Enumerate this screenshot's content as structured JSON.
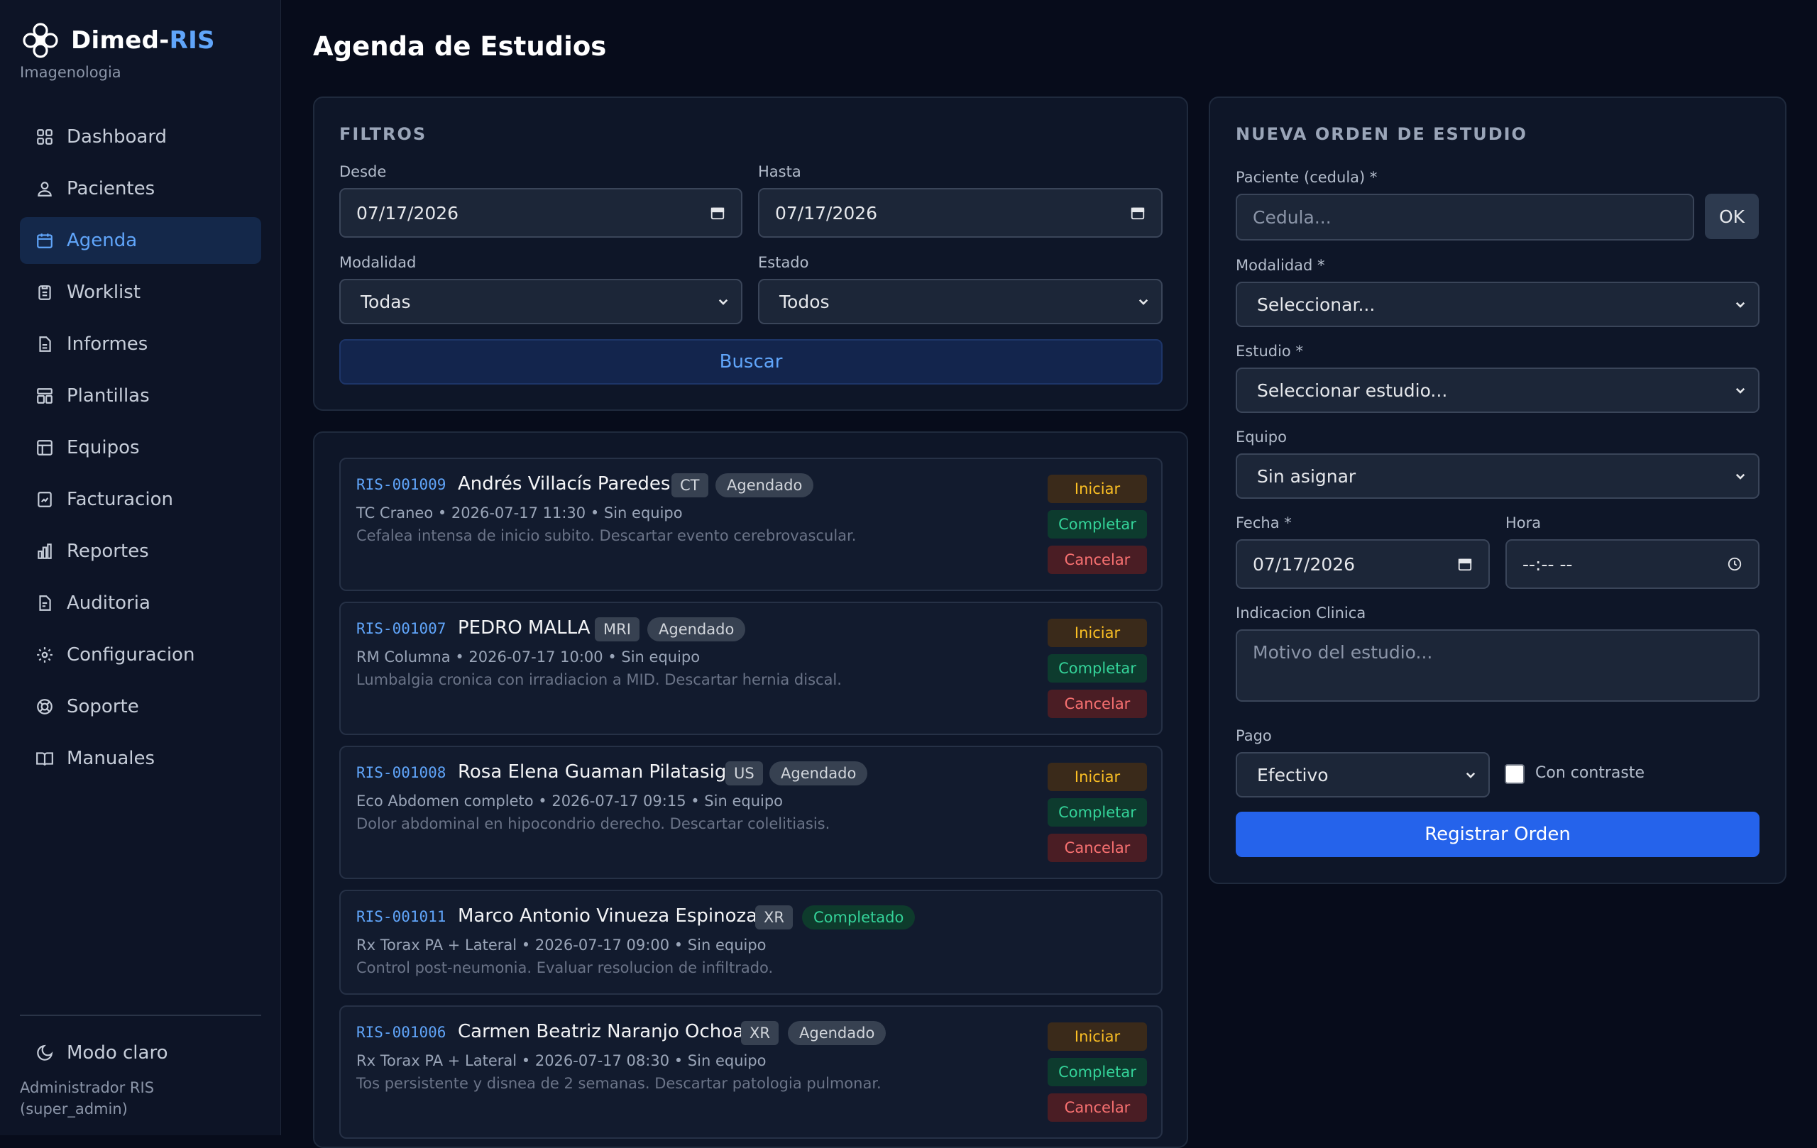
{
  "brand": {
    "name_main": "Dimed-",
    "name_accent": "RIS",
    "subtitle": "Imagenologia"
  },
  "sidebar": {
    "items": [
      {
        "label": "Dashboard",
        "icon": "dashboard-icon"
      },
      {
        "label": "Pacientes",
        "icon": "user-icon"
      },
      {
        "label": "Agenda",
        "icon": "calendar-icon",
        "active": true
      },
      {
        "label": "Worklist",
        "icon": "clipboard-icon"
      },
      {
        "label": "Informes",
        "icon": "document-icon"
      },
      {
        "label": "Plantillas",
        "icon": "template-icon"
      },
      {
        "label": "Equipos",
        "icon": "equipment-icon"
      },
      {
        "label": "Facturacion",
        "icon": "invoice-icon"
      },
      {
        "label": "Reportes",
        "icon": "bar-chart-icon"
      },
      {
        "label": "Auditoria",
        "icon": "audit-icon"
      },
      {
        "label": "Configuracion",
        "icon": "gear-icon"
      },
      {
        "label": "Soporte",
        "icon": "support-icon"
      },
      {
        "label": "Manuales",
        "icon": "book-icon"
      }
    ],
    "theme_toggle": "Modo claro",
    "user_name": "Administrador RIS",
    "user_role": "(super_admin)"
  },
  "page": {
    "title": "Agenda de Estudios"
  },
  "filters": {
    "title": "FILTROS",
    "desde_label": "Desde",
    "desde_value": "07/17/2026",
    "hasta_label": "Hasta",
    "hasta_value": "07/17/2026",
    "modalidad_label": "Modalidad",
    "modalidad_value": "Todas",
    "estado_label": "Estado",
    "estado_value": "Todos",
    "search_button": "Buscar"
  },
  "studies": [
    {
      "code": "RIS-001009",
      "patient": "Andrés Villacís Paredes",
      "modality": "CT",
      "status": "Agendado",
      "meta": "TC Craneo • 2026-07-17 11:30 • Sin equipo",
      "note": "Cefalea intensa de inicio subito. Descartar evento cerebrovascular."
    },
    {
      "code": "RIS-001007",
      "patient": "PEDRO MALLA",
      "modality": "MRI",
      "status": "Agendado",
      "meta": "RM Columna • 2026-07-17 10:00 • Sin equipo",
      "note": "Lumbalgia cronica con irradiacion a MID. Descartar hernia discal."
    },
    {
      "code": "RIS-001008",
      "patient": "Rosa Elena Guaman Pilatasig",
      "modality": "US",
      "status": "Agendado",
      "meta": "Eco Abdomen completo • 2026-07-17 09:15 • Sin equipo",
      "note": "Dolor abdominal en hipocondrio derecho. Descartar colelitiasis."
    },
    {
      "code": "RIS-001011",
      "patient": "Marco Antonio Vinueza Espinoza",
      "modality": "XR",
      "status": "Completado",
      "meta": "Rx Torax PA + Lateral • 2026-07-17 09:00 • Sin equipo",
      "note": "Control post-neumonia. Evaluar resolucion de infiltrado."
    },
    {
      "code": "RIS-001006",
      "patient": "Carmen Beatriz Naranjo Ochoa",
      "modality": "XR",
      "status": "Agendado",
      "meta": "Rx Torax PA + Lateral • 2026-07-17 08:30 • Sin equipo",
      "note": "Tos persistente y disnea de 2 semanas. Descartar patologia pulmonar."
    }
  ],
  "actions": {
    "start": "Iniciar",
    "complete": "Completar",
    "cancel": "Cancelar"
  },
  "new_order": {
    "title": "NUEVA ORDEN DE ESTUDIO",
    "patient_label": "Paciente (cedula) *",
    "patient_placeholder": "Cedula...",
    "ok_button": "OK",
    "modality_label": "Modalidad *",
    "modality_value": "Seleccionar...",
    "study_label": "Estudio *",
    "study_value": "Seleccionar estudio...",
    "equipment_label": "Equipo",
    "equipment_value": "Sin asignar",
    "date_label": "Fecha *",
    "date_value": "07/17/2026",
    "time_label": "Hora",
    "time_value": "--:-- --",
    "indication_label": "Indicacion Clinica",
    "indication_placeholder": "Motivo del estudio...",
    "payment_label": "Pago",
    "payment_value": "Efectivo",
    "contrast_label": "Con contraste",
    "contrast_checked": false,
    "register_button": "Registrar Orden"
  },
  "colors": {
    "accent": "#60a5fa",
    "primary_button": "#2563eb",
    "background": "#070c1b",
    "sidebar": "#0d1426"
  }
}
